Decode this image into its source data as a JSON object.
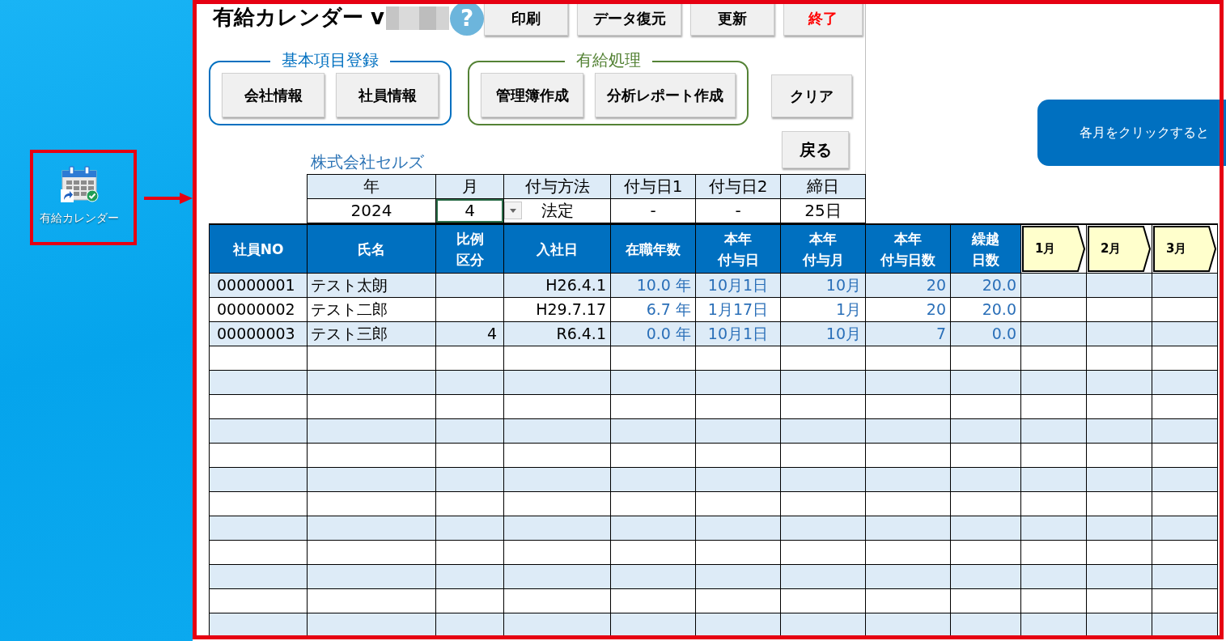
{
  "desktop": {
    "shortcut_label": "有給カレンダー"
  },
  "sheet": {
    "title": "有給カレンダー v",
    "help_button": "?",
    "toolbar_buttons": [
      {
        "label": "印刷",
        "kind": "normal"
      },
      {
        "label": "データ復元",
        "kind": "normal"
      },
      {
        "label": "更新",
        "kind": "normal"
      },
      {
        "label": "終了",
        "kind": "exit"
      }
    ],
    "groups": [
      {
        "title": "基本項目登録",
        "color": "#0070c0",
        "buttons": [
          "会社情報",
          "社員情報"
        ]
      },
      {
        "title": "有給処理",
        "color": "#548235",
        "buttons": [
          "管理簿作成",
          "分析レポート作成"
        ]
      }
    ],
    "clear_button": "クリア",
    "back_button": "戻る",
    "company_name": "株式会社セルズ",
    "banner": "各月をクリックすると",
    "settings": {
      "columns": [
        "年",
        "月",
        "付与方法",
        "付与日1",
        "付与日2",
        "締日"
      ],
      "values": [
        {
          "text": "2024",
          "selected": false
        },
        {
          "text": "4",
          "selected": true
        },
        {
          "text": "法定",
          "selected": false
        },
        {
          "text": "-",
          "selected": false
        },
        {
          "text": "-",
          "selected": false
        },
        {
          "text": "25日",
          "selected": false
        }
      ]
    },
    "table": {
      "columns": [
        [
          "社員NO"
        ],
        [
          "氏名"
        ],
        [
          "比例",
          "区分"
        ],
        [
          "入社日"
        ],
        [
          "在職年数"
        ],
        [
          "本年",
          "付与日"
        ],
        [
          "本年",
          "付与月"
        ],
        [
          "本年",
          "付与日数"
        ],
        [
          "繰越",
          "日数"
        ]
      ],
      "month_tabs": [
        "1月",
        "2月",
        "3月"
      ],
      "rows": [
        {
          "employee_no": "00000001",
          "name": "テスト太朗",
          "hire_date": "H26.4.1",
          "years_employed": "10.0 年",
          "grant_date": "10月1日",
          "grant_month": "10月",
          "grant_days": "20",
          "carryover_days": "20.0"
        },
        {
          "employee_no": "00000002",
          "name": "テスト二郎",
          "hire_date": "H29.7.17",
          "years_employed": "6.7 年",
          "grant_date": "1月17日",
          "grant_month": "1月",
          "grant_days": "20",
          "carryover_days": "20.0"
        },
        {
          "employee_no": "00000003",
          "name": "テスト三郎",
          "ratio_class": "4",
          "hire_date": "R6.4.1",
          "years_employed": "0.0 年",
          "grant_date": "10月1日",
          "grant_month": "10月",
          "grant_days": "7",
          "carryover_days": "0.0"
        }
      ]
    }
  }
}
